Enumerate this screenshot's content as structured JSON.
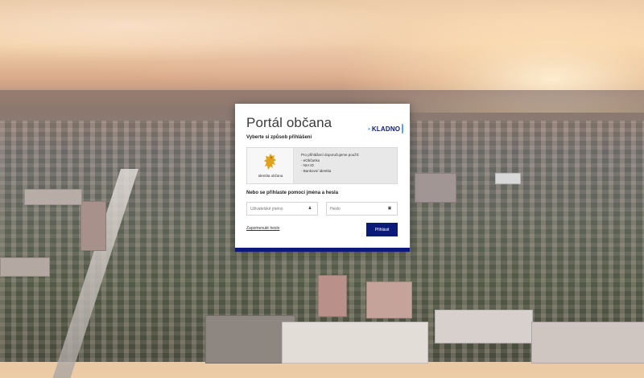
{
  "portal": {
    "title": "Portál občana",
    "logo_text": "KLADNO",
    "choose_login": "Vyberte si způsob přihlášení",
    "identity": {
      "label": "Identita občana",
      "info_lines": [
        "Pro přihlášení doporučujeme použít:",
        "- eObčanku",
        "- NIA ID",
        "- Bankovní identita"
      ]
    },
    "alt_login": "Nebo se přihlaste pomocí jména a hesla",
    "username_placeholder": "Uživatelské jméno",
    "password_placeholder": "Heslo",
    "forgot_password": "Zapomenuté heslo",
    "login_button": "Přihlásit"
  },
  "colors": {
    "brand_navy": "#0b1a7a",
    "brand_light_blue": "#5aa3e0",
    "lion_gold": "#e0a21a"
  },
  "icons": {
    "username_icon": "person-icon",
    "password_icon": "lock-icon",
    "identity_icon": "lion-coat-of-arms-icon"
  }
}
